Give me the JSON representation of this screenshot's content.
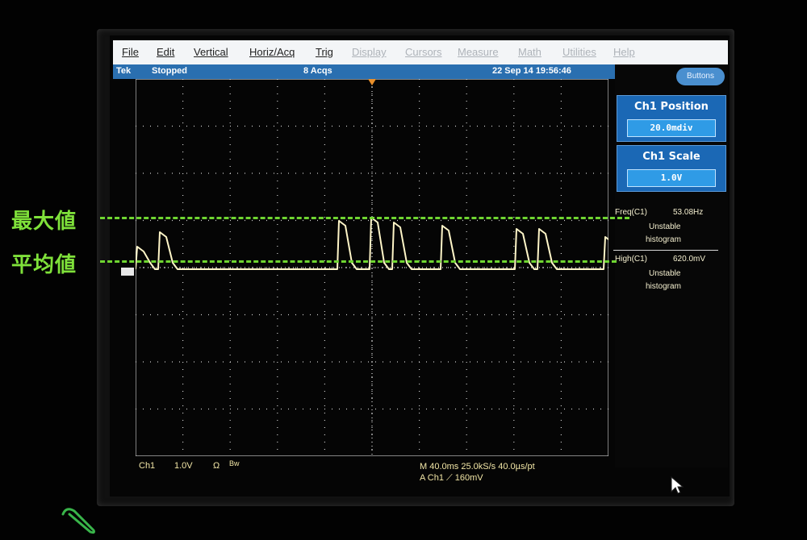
{
  "menu": {
    "items": [
      "File",
      "Edit",
      "Vertical",
      "Horiz/Acq",
      "Trig",
      "Display",
      "Cursors",
      "Measure",
      "Math",
      "Utilities",
      "Help"
    ]
  },
  "status": {
    "brand": "Tek",
    "state": "Stopped",
    "acqs": "8 Acqs",
    "datetime": "22 Sep 14 19:56:46"
  },
  "buttons_label": "Buttons",
  "controls": {
    "position": {
      "title": "Ch1 Position",
      "value": "20.0mdiv"
    },
    "scale": {
      "title": "Ch1 Scale",
      "value": "1.0V"
    }
  },
  "measurements": {
    "freq": {
      "label": "Freq(C1)",
      "value": "53.08Hz",
      "status1": "Unstable",
      "status2": "histogram"
    },
    "high": {
      "label": "High(C1)",
      "value": "620.0mV",
      "status1": "Unstable",
      "status2": "histogram"
    }
  },
  "bottom": {
    "channel": "Ch1",
    "volts": "1.0V",
    "ohm": "Ω",
    "bw": "Bw",
    "timebase": "M 40.0ms 25.0kS/s  40.0µs/pt",
    "trigger": "A  Ch1  ⟋  160mV"
  },
  "annotations": {
    "max_label": "最大値",
    "avg_label": "平均値"
  },
  "colors": {
    "annotation": "#7fe13a",
    "trace": "#fff6c8",
    "statusbar": "#2a6fb0"
  },
  "icons": [
    "paperclip-icon",
    "mouse-cursor-icon",
    "trigger-marker-icon",
    "ground-marker-icon"
  ]
}
